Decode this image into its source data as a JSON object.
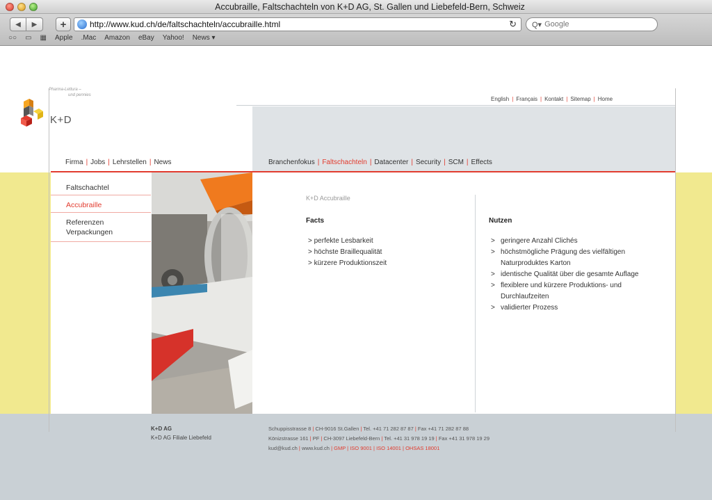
{
  "browser": {
    "window_title": "Accubraille, Faltschachteln von K+D AG, St. Gallen und Liebefeld-Bern, Schweiz",
    "url": "http://www.kud.ch/de/faltschachteln/accubraille.html",
    "search_placeholder": "Google",
    "bookmarks": [
      "Apple",
      ".Mac",
      "Amazon",
      "eBay",
      "Yahoo!",
      "News ▾"
    ]
  },
  "site": {
    "tagline_1": "Pharma-Lettura –",
    "tagline_2": "und pennies",
    "brand": "K+D",
    "lang_nav": [
      "English",
      "Français",
      "Kontakt",
      "Sitemap",
      "Home"
    ],
    "left_nav": [
      "Firma",
      "Jobs",
      "Lehrstellen",
      "News"
    ],
    "main_nav": [
      "Branchenfokus",
      "Faltschachteln",
      "Datacenter",
      "Security",
      "SCM",
      "Effects"
    ],
    "main_nav_active": "Faltschachteln",
    "side_nav": [
      {
        "lines": [
          "Faltschachtel"
        ],
        "active": false
      },
      {
        "lines": [
          "Accubraille"
        ],
        "active": true
      },
      {
        "lines": [
          "Referenzen",
          "Verpackungen"
        ],
        "active": false
      }
    ]
  },
  "content": {
    "title": "K+D Accubraille",
    "facts_heading": "Facts",
    "facts": [
      "perfekte Lesbarkeit",
      "höchste Braillequalität",
      "kürzere Produktionszeit"
    ],
    "nutzen_heading": "Nutzen",
    "nutzen": [
      "geringere Anzahl Clichés",
      "höchstmögliche Prägung des vielfältigen Naturproduktes Karton",
      "identische Qualität über die gesamte Auflage",
      "flexiblere und kürzere Produktions- und Durchlaufzeiten",
      "validierter Prozess"
    ],
    "bullet": ">"
  },
  "footer": {
    "company_1": "K+D AG",
    "company_2": "K+D AG Filiale Liebefeld",
    "addr_1": [
      "Schuppisstrasse 8",
      "CH-9016 St.Gallen",
      "Tel. +41 71 282 87 87",
      "Fax +41 71 282 87 88"
    ],
    "addr_2": [
      "Könizstrasse 161",
      "PF",
      "CH-3097 Liebefeld-Bern",
      "Tel. +41 31 978 19 19",
      "Fax +41 31 978 19 29"
    ],
    "addr_3": [
      "kud@kud.ch",
      "www.kud.ch"
    ],
    "addr_3_red": [
      "GMP",
      "ISO 9001",
      "ISO 14001",
      "OHSAS 18001"
    ]
  },
  "colors": {
    "accent_red": "#e23b2e",
    "band_yellow": "#f1e98f",
    "band_gray": "#c9d0d5",
    "header_gray": "#dfe3e6"
  }
}
